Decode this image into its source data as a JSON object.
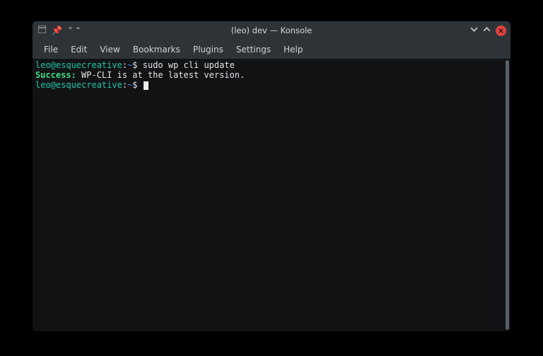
{
  "titlebar": {
    "title": "(leo) dev — Konsole"
  },
  "menubar": {
    "items": [
      {
        "label": "File"
      },
      {
        "label": "Edit"
      },
      {
        "label": "View"
      },
      {
        "label": "Bookmarks"
      },
      {
        "label": "Plugins"
      },
      {
        "label": "Settings"
      },
      {
        "label": "Help"
      }
    ]
  },
  "terminal": {
    "lines": {
      "l1_prompt_userhost": "leo@esquecreative",
      "l1_prompt_colon": ":",
      "l1_prompt_path": "~",
      "l1_prompt_dollar": "$ ",
      "l1_cmd": "sudo wp cli update",
      "l2_success": "Success:",
      "l2_rest": " WP-CLI is at the latest version.",
      "l3_prompt_userhost": "leo@esquecreative",
      "l3_prompt_colon": ":",
      "l3_prompt_path": "~",
      "l3_prompt_dollar": "$ "
    }
  }
}
